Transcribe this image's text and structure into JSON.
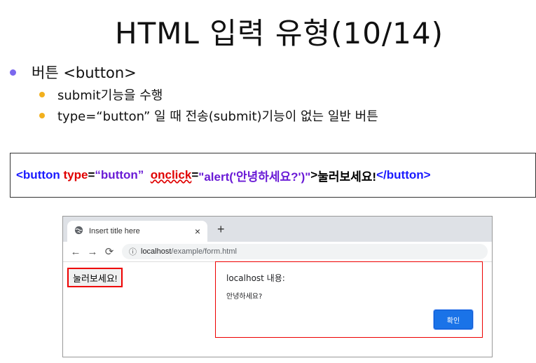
{
  "slide": {
    "title": "HTML 입력 유형(10/14)",
    "bullet_main": "버튼 <button>",
    "bullets_sub": [
      "submit기능을 수행",
      "type=“button” 일 때 전송(submit)기능이 없는 일반 버튼"
    ],
    "code": {
      "tag_open": "<button ",
      "attr_type": "type",
      "eq1": "=",
      "type_val": "“button”",
      "space": "  ",
      "attr_onclick": "onclick",
      "eq2": "=",
      "onclick_val": "\"alert('안녕하세요?')\"",
      "gt": ">",
      "inner_text": "눌러보세요!",
      "tag_close": "</button>"
    },
    "colors": {
      "bullet_main_dot": "#7b68ee",
      "bullet_sub_dot": "#f2b01e",
      "code_tag": "#1a1aff",
      "code_attr": "#e00000",
      "code_value": "#6a1bd6",
      "highlight_border": "#e00000",
      "dialog_button": "#1a73e8"
    }
  },
  "browser": {
    "tab_title": "Insert title here",
    "tab_close": "×",
    "new_tab": "+",
    "tab_icon": "globe-icon",
    "nav": {
      "back": "←",
      "forward": "→",
      "reload": "⟳",
      "info": "ⓘ"
    },
    "url_host": "localhost",
    "url_path": "/example/form.html",
    "page_button_label": "눌러보세요!",
    "dialog": {
      "title": "localhost 내용:",
      "message": "안녕하세요?",
      "ok_label": "확인"
    }
  }
}
